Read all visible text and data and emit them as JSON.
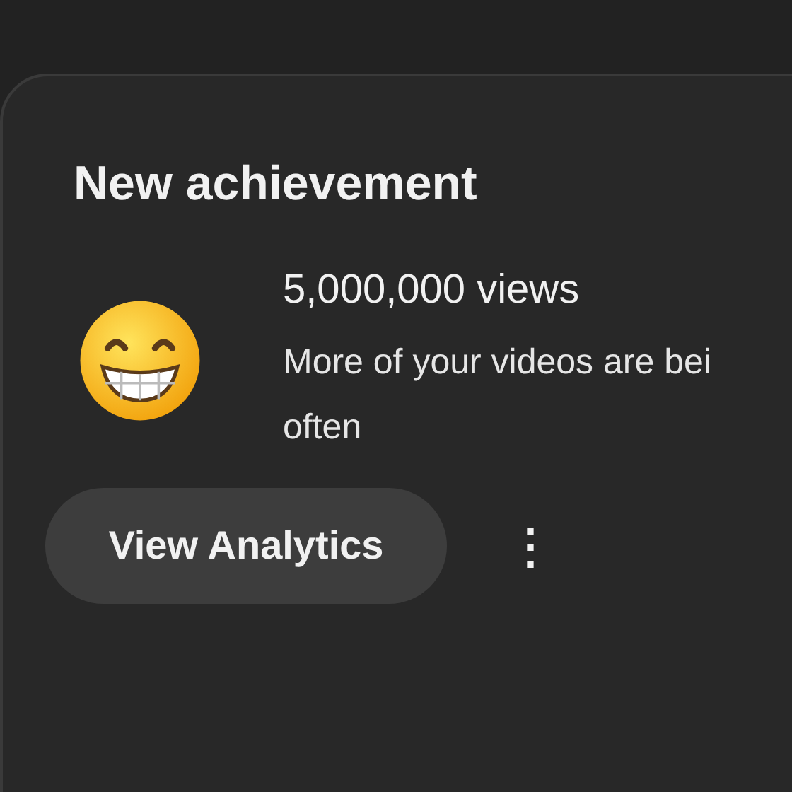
{
  "card": {
    "title": "New achievement",
    "achievement": {
      "headline": "5,000,000 views",
      "description": "More of your videos are bei\noften"
    },
    "button": {
      "label": "View Analytics"
    },
    "more_menu": {
      "label": "⋮"
    }
  }
}
